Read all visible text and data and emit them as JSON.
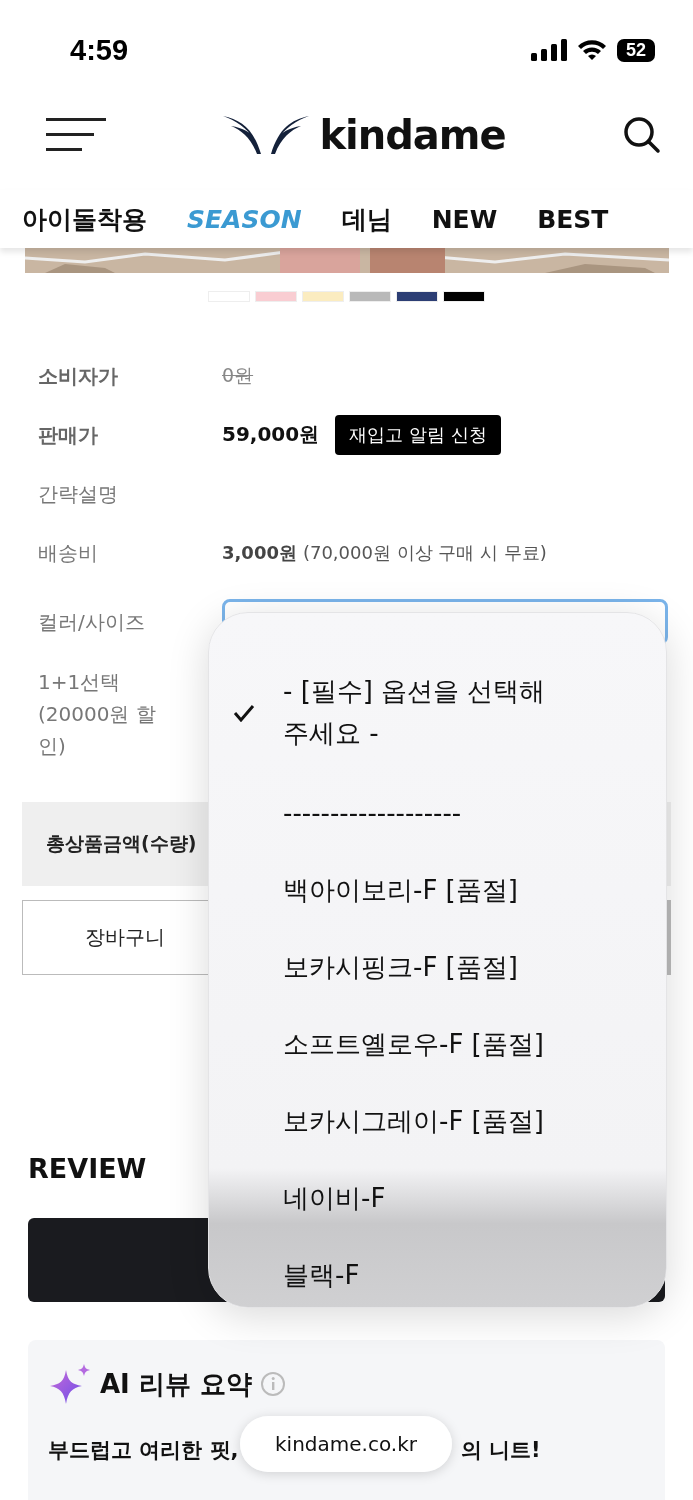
{
  "status_bar": {
    "time": "4:59",
    "battery": "52"
  },
  "header": {
    "logo": "kindame"
  },
  "tabs": [
    {
      "label": "아이돌착용",
      "selected": false
    },
    {
      "label": "SEASON",
      "selected": true
    },
    {
      "label": "데님",
      "selected": false
    },
    {
      "label": "NEW",
      "selected": false
    },
    {
      "label": "BEST",
      "selected": false
    }
  ],
  "swatches": [
    {
      "color": "#ffffff"
    },
    {
      "color": "#f9cdd2"
    },
    {
      "color": "#fbecc0"
    },
    {
      "color": "#b9b9b9"
    },
    {
      "color": "#2c3e74"
    },
    {
      "color": "#000000"
    }
  ],
  "info": [
    {
      "label": "소비자가",
      "kind": "strike",
      "value": "0원"
    },
    {
      "label": "판매가",
      "kind": "price",
      "value": "59,000원",
      "button": "재입고 알림 신청"
    },
    {
      "label": "간략설명",
      "kind": "plain"
    },
    {
      "label": "배송비",
      "kind": "shipping",
      "value": "3,000원",
      "note": "(70,000원 이상 구매 시 무료)"
    },
    {
      "label": "컬러/사이즈",
      "kind": "select"
    },
    {
      "label": "1+1선택\n(20000원 할\n인)",
      "kind": "select2"
    }
  ],
  "total": {
    "label": "총상품금액(수량)"
  },
  "cart_button": "장바구니",
  "review": {
    "title": "REVIEW"
  },
  "ai_summary": {
    "title": "AI 리뷰 요약",
    "text_start": "부드럽고 여리한 핏,",
    "text_end": "의 니트!"
  },
  "dropdown": [
    {
      "label": "- [필수] 옵션을 선택해\n주세요 -",
      "selected": true
    },
    {
      "label": "-------------------",
      "selected": false
    },
    {
      "label": "백아이보리-F [품절]",
      "selected": false
    },
    {
      "label": "보카시핑크-F [품절]",
      "selected": false
    },
    {
      "label": "소프트옐로우-F [품절]",
      "selected": false
    },
    {
      "label": "보카시그레이-F [품절]",
      "selected": false
    },
    {
      "label": "네이비-F",
      "selected": false
    },
    {
      "label": "블랙-F",
      "selected": false
    }
  ],
  "url_bar": {
    "url": "kindame.co.kr"
  }
}
